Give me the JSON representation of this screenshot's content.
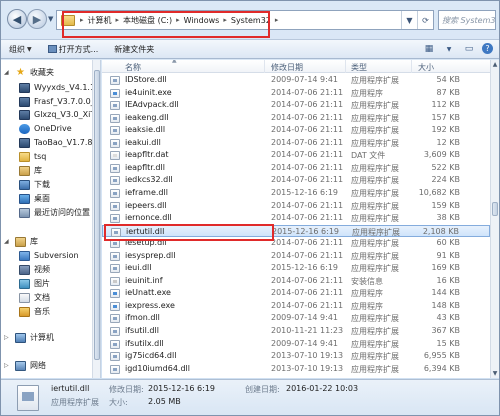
{
  "address": {
    "crumbs": [
      "计算机",
      "本地磁盘 (C:)",
      "Windows",
      "System32"
    ],
    "search_placeholder": "搜索 System32"
  },
  "toolbar": {
    "organize": "组织",
    "open": "打开方式...",
    "new_folder": "新建文件夹"
  },
  "navpane": {
    "favorites": "收藏夹",
    "items": [
      "Wyyxds_V4.1.1...",
      "Frasf_V3.7.0.0_X...",
      "Glxzq_V3.0_XiTo...",
      "OneDrive",
      "TaoBao_V1.7.8...",
      "tsq",
      "库",
      "下载",
      "桌面",
      "最近访问的位置"
    ],
    "libraries": "库",
    "lib_items": [
      "Subversion",
      "视频",
      "图片",
      "文档",
      "音乐"
    ],
    "computer": "计算机",
    "network": "网络"
  },
  "columns": {
    "name": "名称",
    "date": "修改日期",
    "type": "类型",
    "size": "大小"
  },
  "files": [
    {
      "name": "IDStore.dll",
      "date": "2009-07-14 9:41",
      "type": "应用程序扩展",
      "size": "54 KB",
      "kind": "dll"
    },
    {
      "name": "ie4uinit.exe",
      "date": "2014-07-06 21:11",
      "type": "应用程序",
      "size": "87 KB",
      "kind": "exe"
    },
    {
      "name": "IEAdvpack.dll",
      "date": "2014-07-06 21:11",
      "type": "应用程序扩展",
      "size": "112 KB",
      "kind": "dll"
    },
    {
      "name": "ieakeng.dll",
      "date": "2014-07-06 21:11",
      "type": "应用程序扩展",
      "size": "157 KB",
      "kind": "dll"
    },
    {
      "name": "ieaksie.dll",
      "date": "2014-07-06 21:11",
      "type": "应用程序扩展",
      "size": "192 KB",
      "kind": "dll"
    },
    {
      "name": "ieakui.dll",
      "date": "2014-07-06 21:11",
      "type": "应用程序扩展",
      "size": "12 KB",
      "kind": "dll"
    },
    {
      "name": "ieapfltr.dat",
      "date": "2014-07-06 21:11",
      "type": "DAT 文件",
      "size": "3,609 KB",
      "kind": "dat"
    },
    {
      "name": "ieapfltr.dll",
      "date": "2014-07-06 21:11",
      "type": "应用程序扩展",
      "size": "522 KB",
      "kind": "dll"
    },
    {
      "name": "iedkcs32.dll",
      "date": "2014-07-06 21:11",
      "type": "应用程序扩展",
      "size": "224 KB",
      "kind": "dll"
    },
    {
      "name": "ieframe.dll",
      "date": "2015-12-16 6:19",
      "type": "应用程序扩展",
      "size": "10,682 KB",
      "kind": "dll"
    },
    {
      "name": "iepeers.dll",
      "date": "2014-07-06 21:11",
      "type": "应用程序扩展",
      "size": "159 KB",
      "kind": "dll"
    },
    {
      "name": "iernonce.dll",
      "date": "2014-07-06 21:11",
      "type": "应用程序扩展",
      "size": "38 KB",
      "kind": "dll"
    },
    {
      "name": "iertutil.dll",
      "date": "2015-12-16 6:19",
      "type": "应用程序扩展",
      "size": "2,108 KB",
      "kind": "dll",
      "selected": true
    },
    {
      "name": "iesetup.dll",
      "date": "2014-07-06 21:11",
      "type": "应用程序扩展",
      "size": "60 KB",
      "kind": "dll"
    },
    {
      "name": "iesysprep.dll",
      "date": "2014-07-06 21:11",
      "type": "应用程序扩展",
      "size": "91 KB",
      "kind": "dll"
    },
    {
      "name": "ieui.dll",
      "date": "2015-12-16 6:19",
      "type": "应用程序扩展",
      "size": "169 KB",
      "kind": "dll"
    },
    {
      "name": "ieuinit.inf",
      "date": "2014-07-06 21:11",
      "type": "安装信息",
      "size": "16 KB",
      "kind": "inf"
    },
    {
      "name": "ieUnatt.exe",
      "date": "2014-07-06 21:11",
      "type": "应用程序",
      "size": "144 KB",
      "kind": "exe"
    },
    {
      "name": "iexpress.exe",
      "date": "2014-07-06 21:11",
      "type": "应用程序",
      "size": "148 KB",
      "kind": "exe"
    },
    {
      "name": "ifmon.dll",
      "date": "2009-07-14 9:41",
      "type": "应用程序扩展",
      "size": "43 KB",
      "kind": "dll"
    },
    {
      "name": "ifsutil.dll",
      "date": "2010-11-21 11:23",
      "type": "应用程序扩展",
      "size": "367 KB",
      "kind": "dll"
    },
    {
      "name": "ifsutilx.dll",
      "date": "2009-07-14 9:41",
      "type": "应用程序扩展",
      "size": "15 KB",
      "kind": "dll"
    },
    {
      "name": "ig75icd64.dll",
      "date": "2013-07-10 19:13",
      "type": "应用程序扩展",
      "size": "6,955 KB",
      "kind": "dll"
    },
    {
      "name": "igd10iumd64.dll",
      "date": "2013-07-10 19:13",
      "type": "应用程序扩展",
      "size": "6,394 KB",
      "kind": "dll"
    }
  ],
  "details": {
    "name": "iertutil.dll",
    "type": "应用程序扩展",
    "modified_label": "修改日期:",
    "modified": "2015-12-16 6:19",
    "created_label": "创建日期:",
    "created": "2016-01-22 10:03",
    "size_label": "大小:",
    "size": "2.05 MB"
  },
  "colors": {
    "highlight_box": "#e02a2a",
    "selection": "#cfe4fb"
  }
}
